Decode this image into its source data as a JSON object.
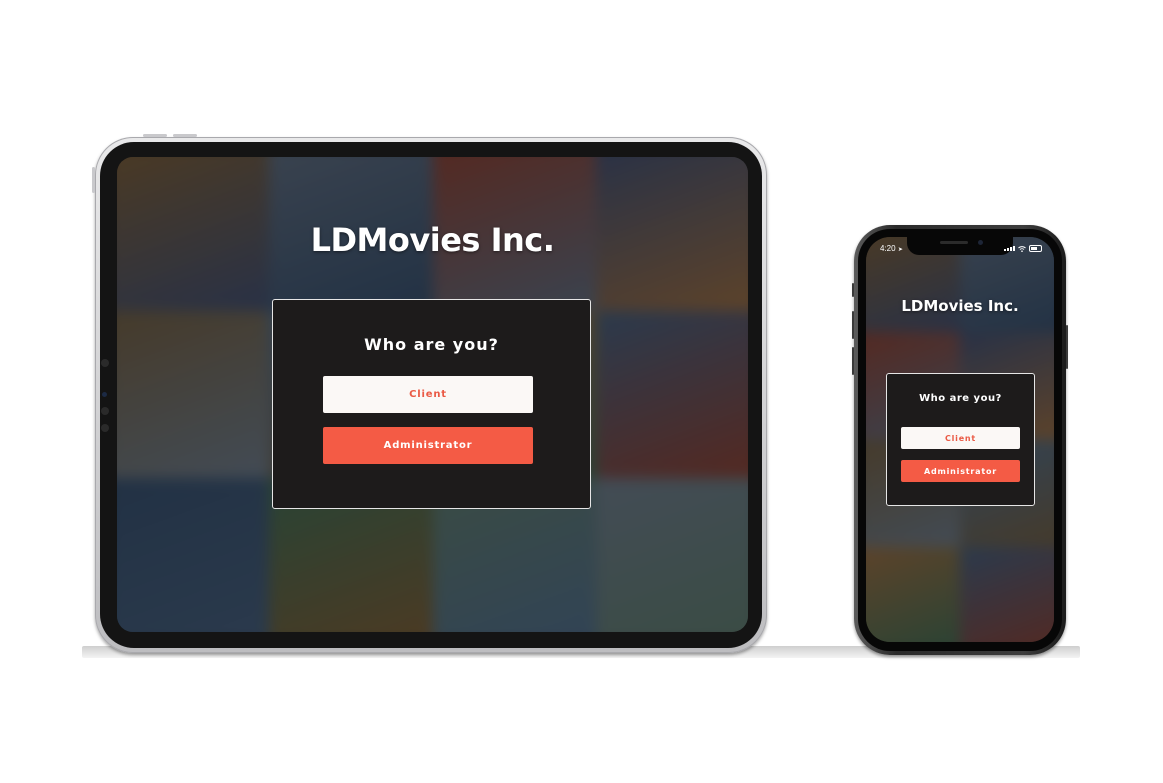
{
  "brand": {
    "title": "LDMovies Inc."
  },
  "role_prompt": {
    "heading": "Who are you?",
    "client_label": "Client",
    "admin_label": "Administrator"
  },
  "phone_status": {
    "time": "4:20",
    "location_glyph": "➤"
  },
  "colors": {
    "accent": "#f45b45",
    "card_bg": "#1d1b1b",
    "client_bg": "#fbf8f6"
  },
  "poster_palette": [
    "#7a5a2e",
    "#5a6a7e",
    "#8a3a2a",
    "#3a4a6e",
    "#6e5a3a",
    "#4a6a8a",
    "#9a6a3a",
    "#3e5a7a",
    "#2e4a6a",
    "#3a6a4e",
    "#5a7a6a",
    "#6a7a8a"
  ]
}
